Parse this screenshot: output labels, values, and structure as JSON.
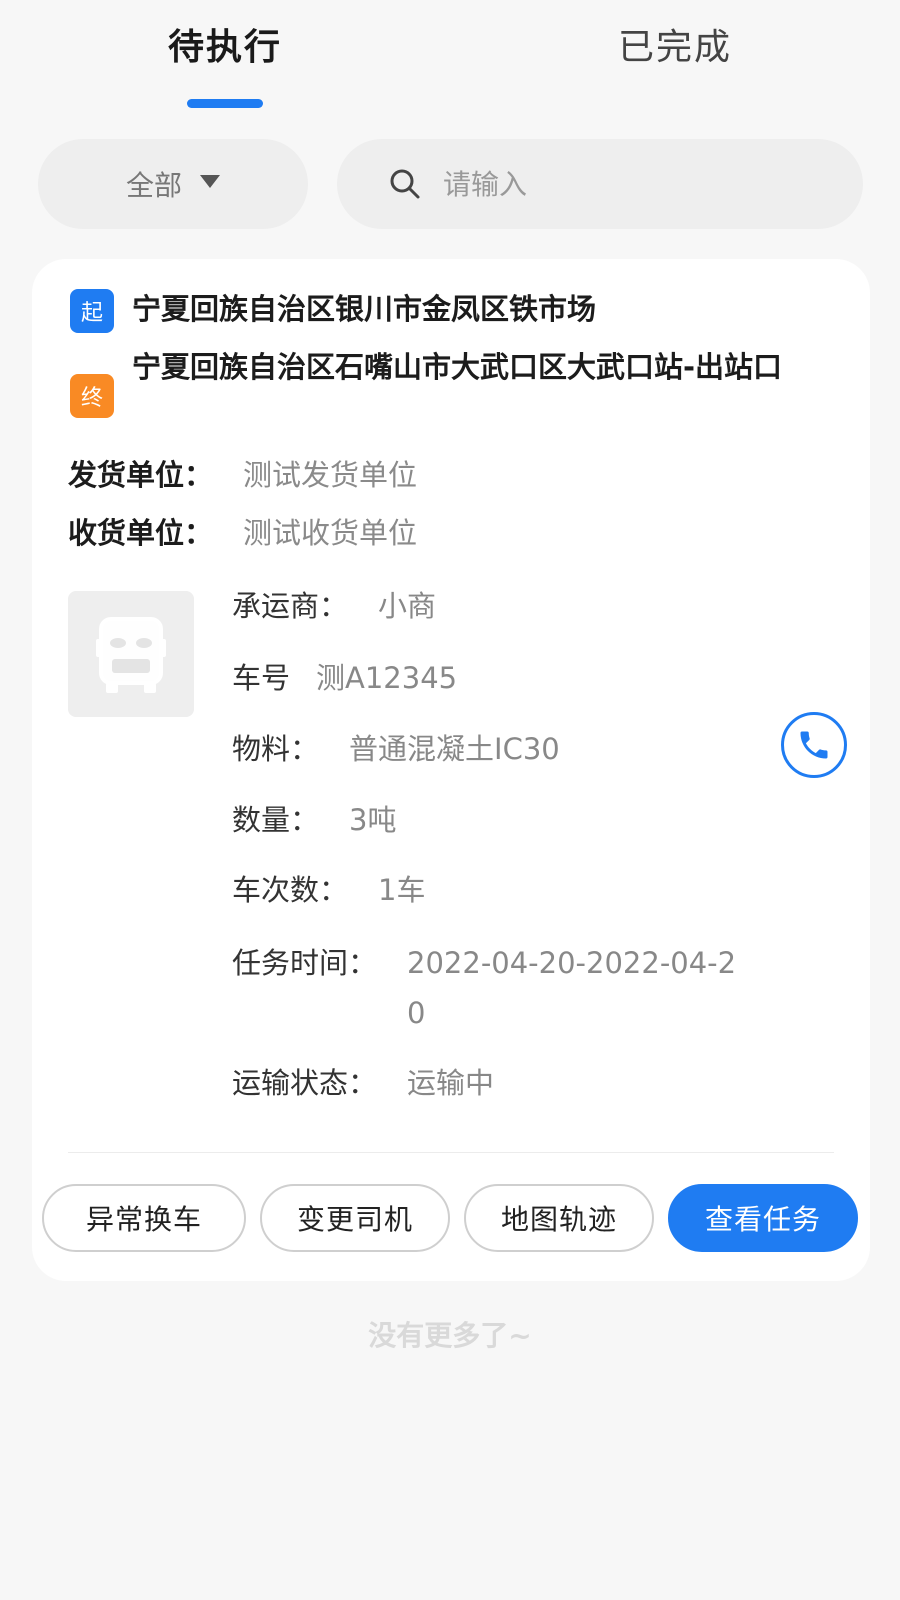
{
  "tabs": [
    {
      "label": "待执行",
      "active": true
    },
    {
      "label": "已完成",
      "active": false
    }
  ],
  "filter": {
    "selected": "全部"
  },
  "search": {
    "placeholder": "请输入",
    "value": ""
  },
  "order": {
    "start_badge": "起",
    "end_badge": "终",
    "start_location": "宁夏回族自治区银川市金凤区铁市场",
    "end_location": "宁夏回族自治区石嘴山市大武口区大武口站-出站口",
    "shipper_label": "发货单位：",
    "shipper_value": "测试发货单位",
    "receiver_label": "收货单位：",
    "receiver_value": "测试收货单位",
    "details": [
      {
        "label": "承运商：",
        "value": "小商"
      },
      {
        "label": "车号",
        "value": "测A12345"
      },
      {
        "label": "物料：",
        "value": "普通混凝土IC30"
      },
      {
        "label": "数量：",
        "value": "3吨"
      },
      {
        "label": "车次数：",
        "value": "1车"
      },
      {
        "label": "任务时间：",
        "value": "2022-04-20-2022-04-20"
      },
      {
        "label": "运输状态：",
        "value": "运输中"
      }
    ],
    "actions": [
      {
        "label": "异常换车"
      },
      {
        "label": "变更司机"
      },
      {
        "label": "地图轨迹"
      },
      {
        "label": "查看任务"
      }
    ]
  },
  "footer": {
    "text": "没有更多了~"
  },
  "colors": {
    "accent": "#1f7cf2",
    "end_badge": "#f98a24"
  }
}
